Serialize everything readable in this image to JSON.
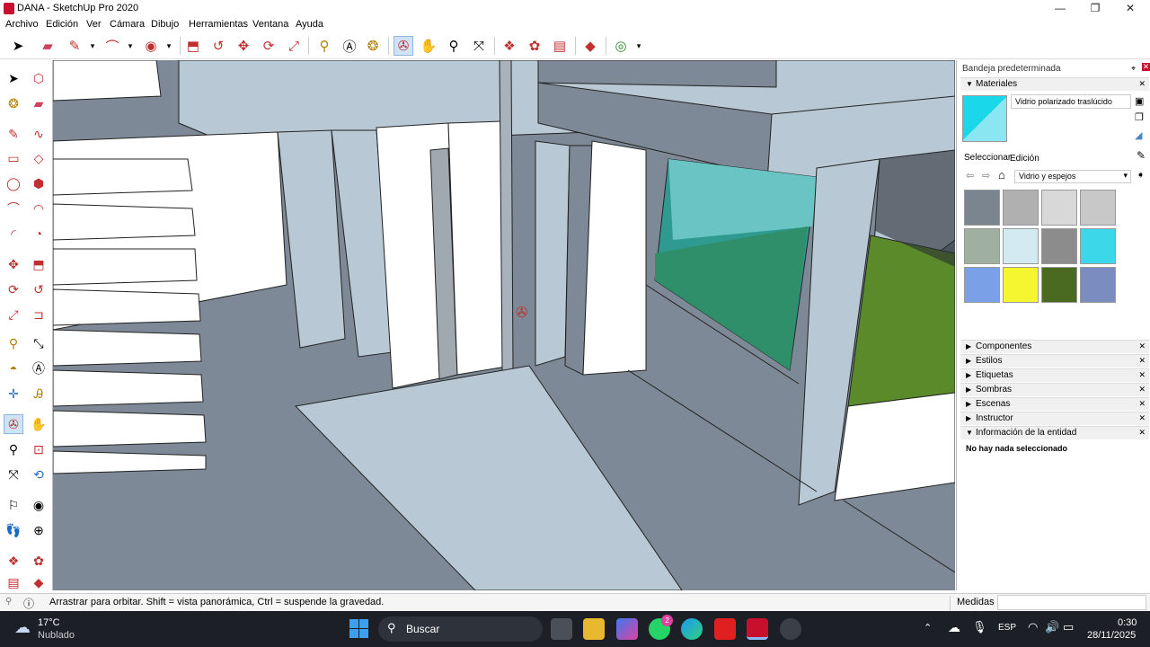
{
  "window": {
    "title": "DANA - SketchUp Pro 2020",
    "minimize": "—",
    "maximize": "❐",
    "close": "✕"
  },
  "menu": [
    "Archivo",
    "Edición",
    "Ver",
    "Cámara",
    "Dibujo",
    "Herramientas",
    "Ventana",
    "Ayuda"
  ],
  "tray": {
    "title": "Bandeja predeterminada",
    "materials": {
      "header": "Materiales",
      "current_name": "Vidrio polarizado traslúcido",
      "tab_select": "Seleccionar",
      "tab_edit": "Edición",
      "library": "Vidrio y espejos",
      "swatch_colors": [
        "#7a8590",
        "#b0b0b0",
        "#d8d8d8",
        "#c8c8c8",
        "#9fb0a0",
        "#d4eaf2",
        "#8c8c8c",
        "#3cd8ea",
        "#7aa0e8",
        "#f5f530",
        "#4a6a20",
        "#7a8cc0"
      ]
    },
    "panels": [
      "Componentes",
      "Estilos",
      "Etiquetas",
      "Sombras",
      "Escenas",
      "Instructor"
    ],
    "entity_info": {
      "header": "Información de la entidad",
      "text": "No hay nada seleccionado"
    }
  },
  "status": {
    "hint": "Arrastrar para orbitar. Shift = vista panorámica, Ctrl = suspende la gravedad.",
    "measures_label": "Medidas",
    "measures_value": ""
  },
  "taskbar": {
    "weather_temp": "17°C",
    "weather_desc": "Nublado",
    "search": "Buscar",
    "lang": "ESP",
    "time": "0:30",
    "date": "28/11/2025",
    "whatsapp_badge": "2"
  },
  "colors": {
    "wall_light": "#b8c8d4",
    "wall_white": "#ffffff",
    "floor": "#7a8794",
    "grass": "#5a8a2a",
    "glass": "#3aa8a8",
    "accent": "#c8102e"
  }
}
